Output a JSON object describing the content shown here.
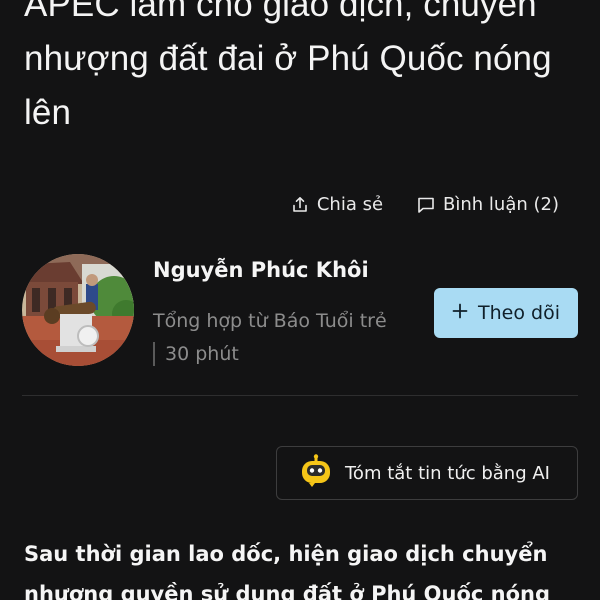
{
  "article": {
    "headline": "APEC làm cho giao dịch, chuyển nhượng đất đai ở Phú Quốc nóng lên",
    "lead": "Sau thời gian lao dốc, hiện giao dịch chuyển nhượng quyền sử dụng đất ở Phú Quốc nóng"
  },
  "actions": {
    "share_label": "Chia sẻ",
    "share_icon": "share-icon",
    "comment_label": "Bình luận (2)",
    "comment_icon": "comment-icon"
  },
  "author": {
    "name": "Nguyễn Phúc Khôi",
    "source": "Tổng hợp từ Báo Tuổi trẻ",
    "time": "30 phút",
    "follow_label": "Theo dõi",
    "follow_icon": "plus-icon"
  },
  "ai_summary": {
    "label": "Tóm tắt tin tức bằng AI",
    "icon": "robot-icon"
  },
  "colors": {
    "background": "#131314",
    "follow_button": "#a9dbf3",
    "robot_icon": "#f5c518",
    "muted_text": "#8c8c8c"
  }
}
